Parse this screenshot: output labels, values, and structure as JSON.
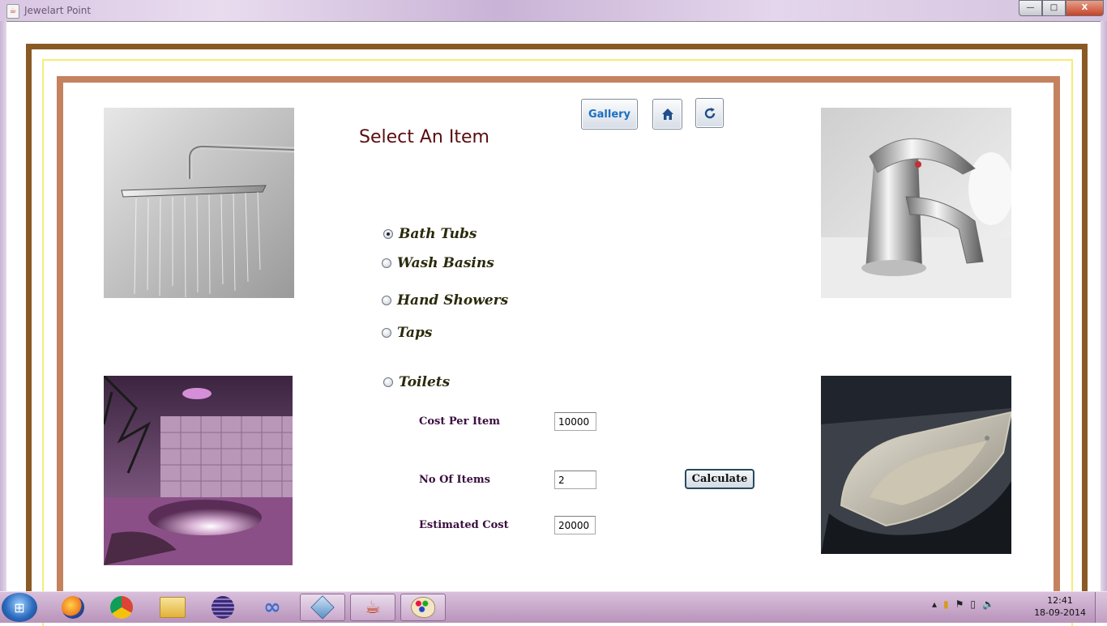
{
  "window": {
    "title": "Jewelart Point",
    "controls": {
      "minimize": "—",
      "maximize": "□",
      "close": "X"
    }
  },
  "toolbar": {
    "gallery_label": "Gallery",
    "home_icon": "home-icon",
    "refresh_icon": "refresh-icon"
  },
  "page_title": "Select An Item",
  "items": [
    {
      "label": "Bath Tubs",
      "selected": true
    },
    {
      "label": "Wash Basins",
      "selected": false
    },
    {
      "label": "Hand Showers",
      "selected": false
    },
    {
      "label": "Taps",
      "selected": false
    },
    {
      "label": "Toilets",
      "selected": false
    }
  ],
  "form": {
    "cost_label": "Cost Per Item",
    "cost_value": "10000",
    "qty_label": "No Of Items",
    "qty_value": "2",
    "estimate_label": "Estimated Cost",
    "estimate_value": "20000",
    "calculate_label": "Calculate"
  },
  "images": [
    "shower-photo",
    "tap-photo",
    "bathroom-photo",
    "basin-photo"
  ],
  "taskbar": {
    "apps": [
      "firefox-icon",
      "chrome-icon",
      "explorer-icon",
      "eclipse-icon",
      "infinity-icon",
      "virtualbox-icon",
      "java-icon",
      "paint-icon"
    ],
    "time": "12:41",
    "date": "18-09-2014"
  },
  "colors": {
    "outer_frame": "#8a5a24",
    "middle_frame": "#f3ee74",
    "inner_frame": "#c4825f",
    "title_color": "#5a0d10"
  }
}
